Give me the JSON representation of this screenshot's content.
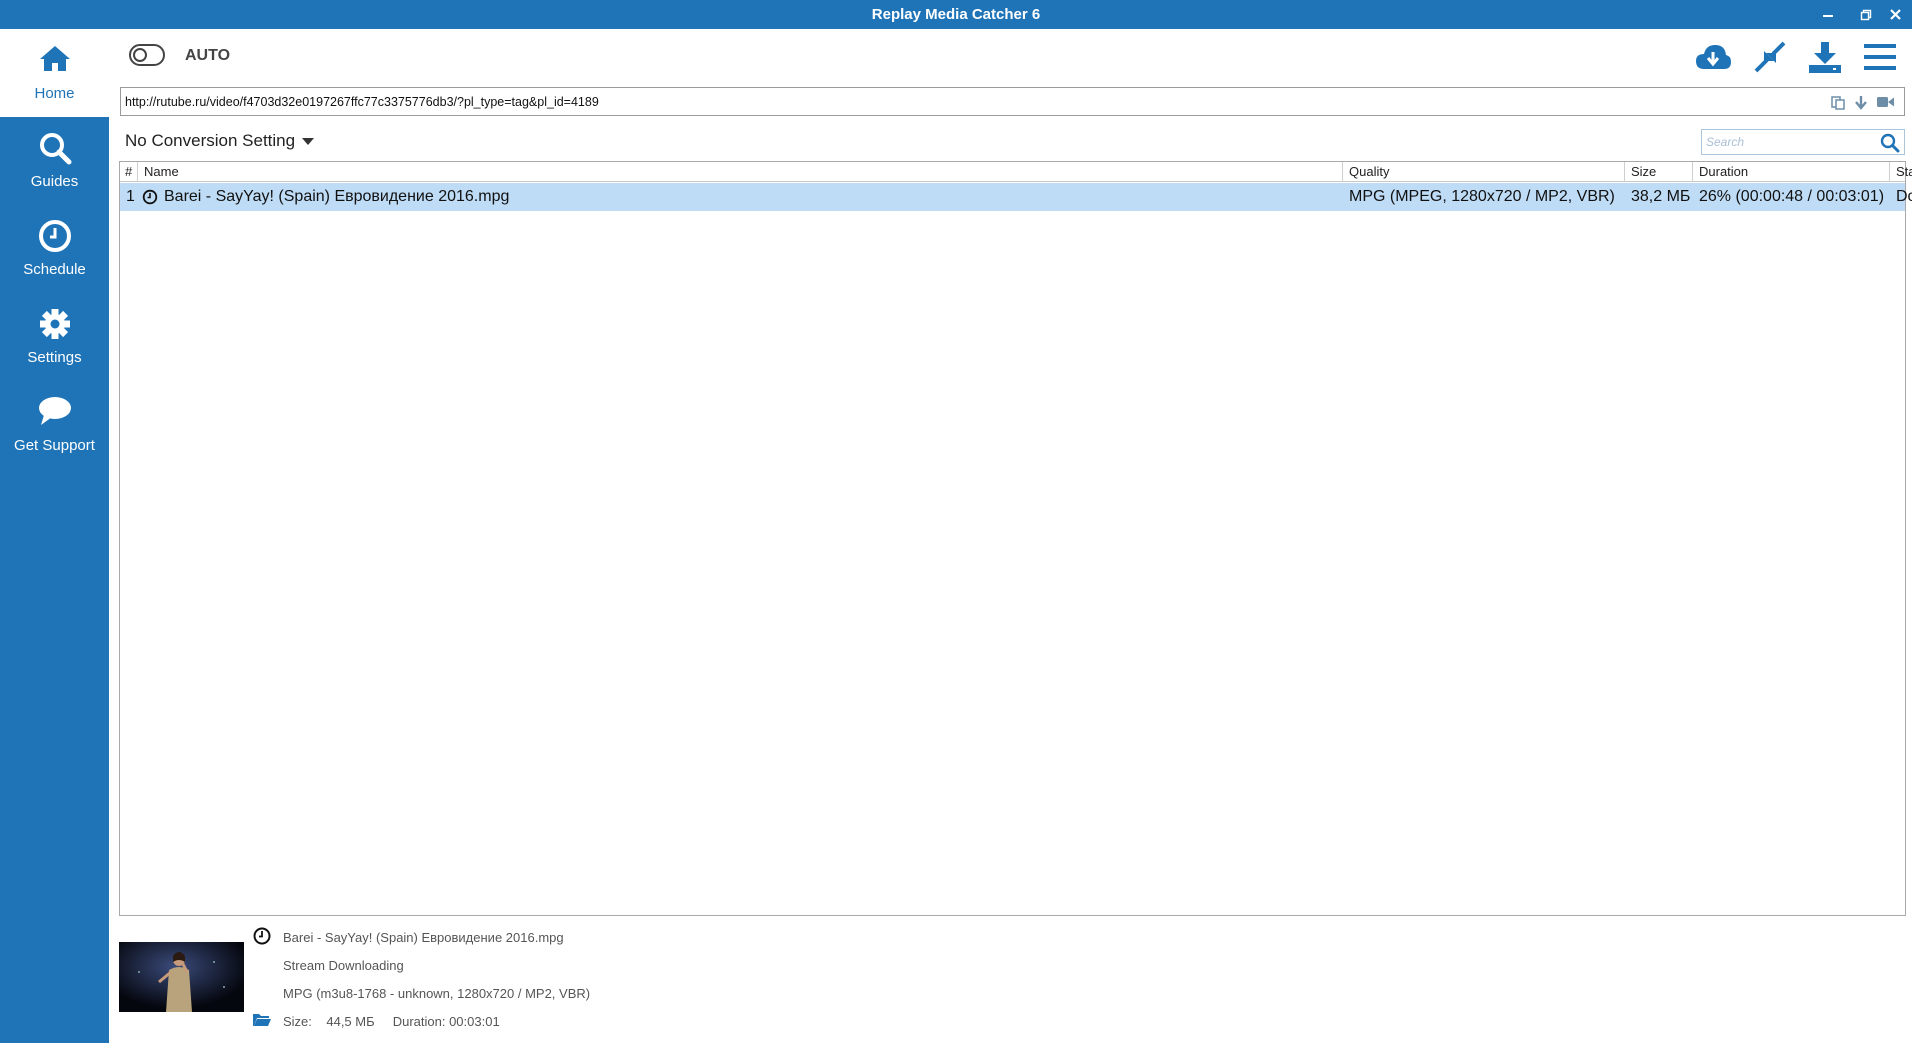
{
  "window": {
    "title": "Replay Media Catcher 6"
  },
  "sidebar": {
    "items": [
      {
        "label": "Home",
        "icon": "home-icon",
        "active": true
      },
      {
        "label": "Guides",
        "icon": "search-icon"
      },
      {
        "label": "Schedule",
        "icon": "clock-icon"
      },
      {
        "label": "Settings",
        "icon": "gear-icon"
      },
      {
        "label": "Get Support",
        "icon": "chat-bubble-icon"
      }
    ]
  },
  "toolbar": {
    "auto_label": "AUTO",
    "auto_enabled": false,
    "icons": [
      "cloud-download-icon",
      "compress-icon",
      "download-tray-icon",
      "hamburger-menu-icon"
    ]
  },
  "url_bar": {
    "value": "http://rutube.ru/video/f4703d32e0197267ffc77c3375776db3/?pl_type=tag&pl_id=4189"
  },
  "conversion": {
    "label": "No Conversion Setting"
  },
  "search": {
    "placeholder": "Search"
  },
  "table": {
    "columns": [
      "#",
      "Name",
      "Quality",
      "Size",
      "Duration",
      "Status"
    ],
    "rows": [
      {
        "num": "1",
        "name": "Barei - SayYay! (Spain) Евровидение 2016.mpg",
        "quality": "MPG  (MPEG, 1280x720 / MP2, VBR)",
        "size": "38,2 МБ",
        "duration": "26% (00:00:48 / 00:03:01)",
        "status": "Downloading"
      }
    ]
  },
  "details": {
    "filename": "Barei - SayYay! (Spain) Евровидение 2016.mpg",
    "state": "Stream Downloading",
    "format": "MPG  (m3u8-1768 - unknown, 1280x720 / MP2, VBR)",
    "size_label": "Size:",
    "size_value": "44,5 МБ",
    "duration_label": "Duration:",
    "duration_value": "00:03:01"
  },
  "colors": {
    "accent": "#1f74b8",
    "selection": "#bfdcf6"
  }
}
